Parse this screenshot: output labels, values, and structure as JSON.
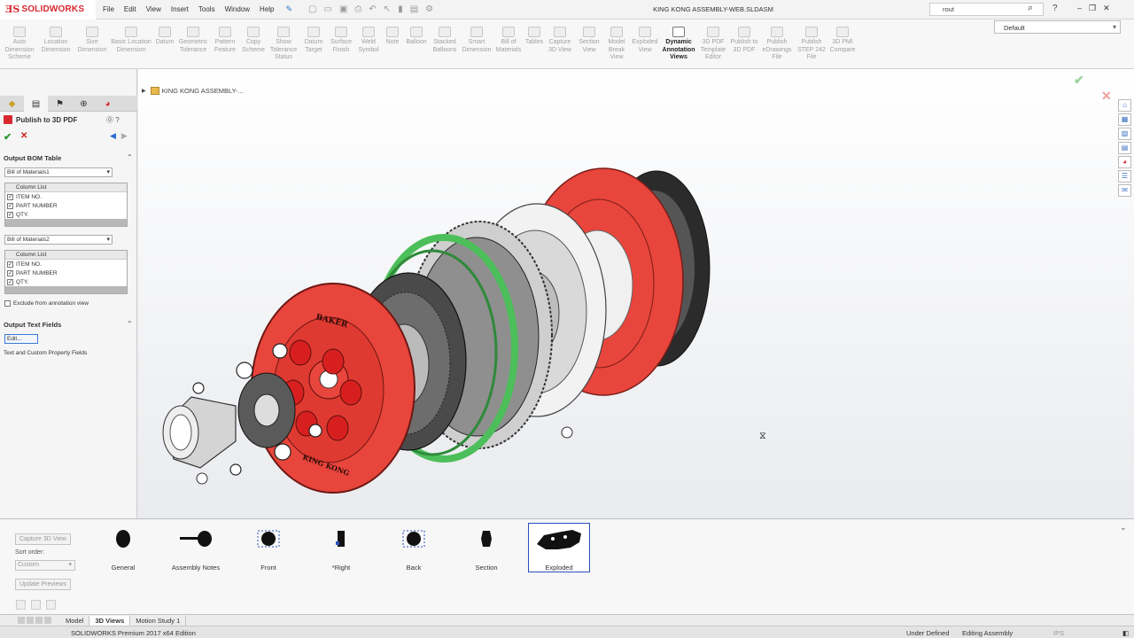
{
  "app": {
    "logo_ds": "ƎS",
    "logo_text": "SOLIDWORKS",
    "document_title": "KING KONG ASSEMBLY-WEB.SLDASM"
  },
  "menu": [
    "File",
    "Edit",
    "View",
    "Insert",
    "Tools",
    "Window",
    "Help"
  ],
  "search": {
    "value": "rout"
  },
  "configuration": {
    "selected": "Default"
  },
  "command_manager": [
    {
      "label": "Auto Dimension Scheme"
    },
    {
      "label": "Location Dimension"
    },
    {
      "label": "Size Dimension"
    },
    {
      "label": "Basic Location Dimension"
    },
    {
      "label": "Datum"
    },
    {
      "label": "Geometric Tolerance"
    },
    {
      "label": "Pattern Feature"
    },
    {
      "label": "Copy Scheme"
    },
    {
      "label": "Show Tolerance Status"
    },
    {
      "label": "Datum Target"
    },
    {
      "label": "Surface Finish"
    },
    {
      "label": "Weld Symbol"
    },
    {
      "label": "Note"
    },
    {
      "label": "Balloon"
    },
    {
      "label": "Stacked Balloons"
    },
    {
      "label": "Smart Dimension"
    },
    {
      "label": "Bill of Materials"
    },
    {
      "label": "Tables"
    },
    {
      "label": "Capture 3D View"
    },
    {
      "label": "Section View"
    },
    {
      "label": "Model Break View"
    },
    {
      "label": "Exploded View"
    },
    {
      "label": "Dynamic Annotation Views"
    },
    {
      "label": "3D PDF Template Editor"
    },
    {
      "label": "Publish to 3D PDF"
    },
    {
      "label": "Publish eDrawings File"
    },
    {
      "label": "Publish STEP 242 File"
    },
    {
      "label": "3D PMI Compare"
    }
  ],
  "property_manager": {
    "title": "Publish to 3D PDF",
    "section_bom": "Output BOM Table",
    "bom1": {
      "selected": "Bill of Materials1",
      "header": "Column List",
      "rows": [
        "ITEM NO.",
        "PART NUMBER",
        "QTY."
      ]
    },
    "bom2": {
      "selected": "Bill of Materials2",
      "header": "Column List",
      "rows": [
        "ITEM NO.",
        "PART NUMBER",
        "QTY."
      ]
    },
    "exclude_label": "Exclude from annotation view",
    "section_text": "Output Text Fields",
    "edit_button": "Edit...",
    "text_fields_label": "Text and Custom Property Fields"
  },
  "viewport": {
    "tree_root": "KING KONG ASSEMBLY-..."
  },
  "views_panel": {
    "capture_button": "Capture 3D View",
    "sort_label": "Sort order:",
    "sort_selected": "Custom",
    "update_button": "Update Previews",
    "views": [
      {
        "name": "General"
      },
      {
        "name": "Assembly Notes"
      },
      {
        "name": "Front"
      },
      {
        "name": "*Right"
      },
      {
        "name": "Back"
      },
      {
        "name": "Section"
      },
      {
        "name": "Exploded"
      }
    ]
  },
  "bottom_tabs": [
    "Model",
    "3D Views",
    "Motion Study 1"
  ],
  "status": {
    "edition": "SOLIDWORKS Premium 2017 x64 Edition",
    "state": "Under Defined",
    "mode": "Editing Assembly",
    "units": "IPS"
  },
  "colors": {
    "brand": "#d8282f",
    "part_red": "#e8453c",
    "part_green": "#4cbf5a",
    "selection_blue": "#2a4fc0"
  }
}
